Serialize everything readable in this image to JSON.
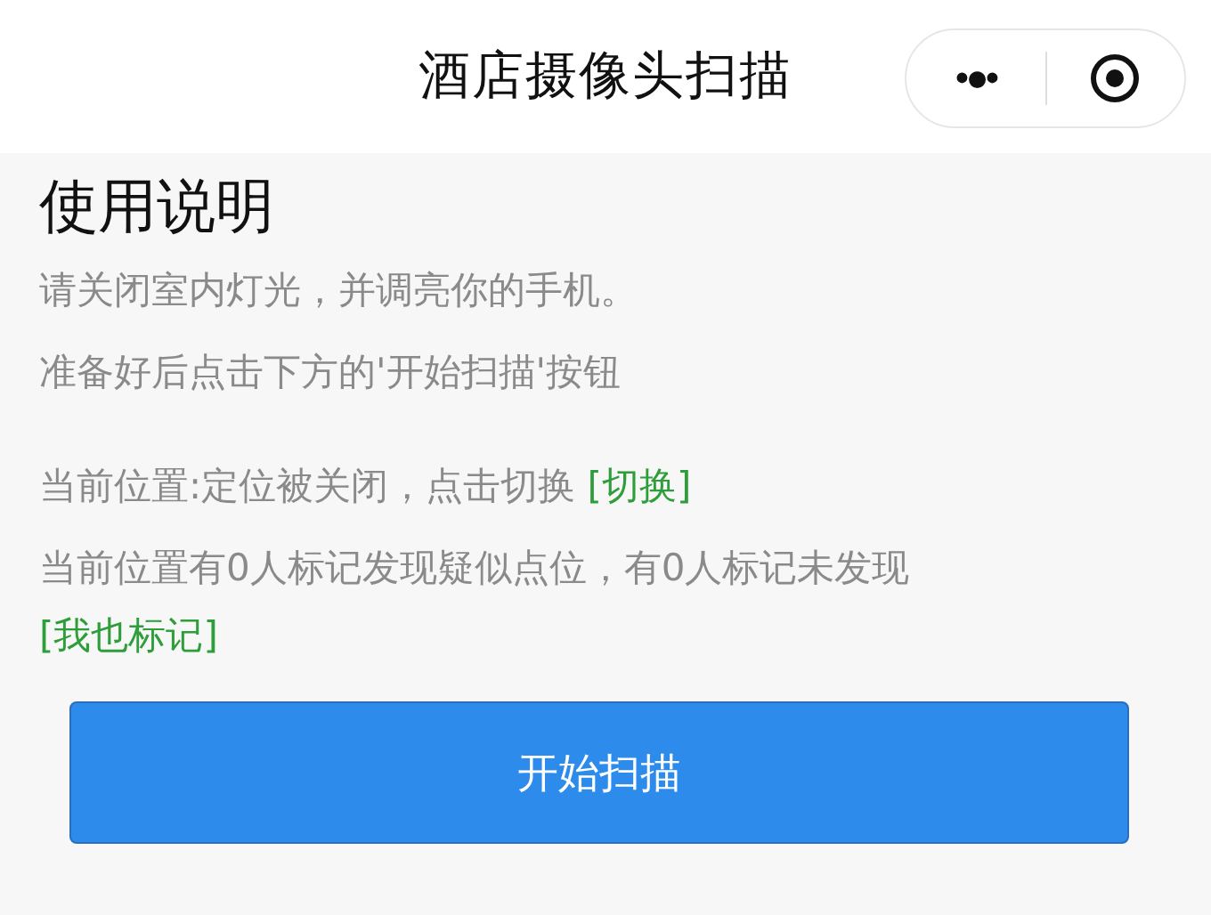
{
  "nav_bar": {
    "title": "酒店摄像头扫描",
    "more_icon": "•●•"
  },
  "instructions": {
    "heading": "使用说明",
    "lines": [
      "请关闭室内灯光，并调亮你的手机。",
      "准备好后点击下方的'开始扫描'按钮"
    ]
  },
  "location": {
    "text": "当前位置:定位被关闭，点击切换",
    "link": "[切换]"
  },
  "marks": {
    "text": "当前位置有0人标记发现疑似点位，有0人标记未发现",
    "link": "[我也标记]"
  },
  "scan_button": "开始扫描"
}
